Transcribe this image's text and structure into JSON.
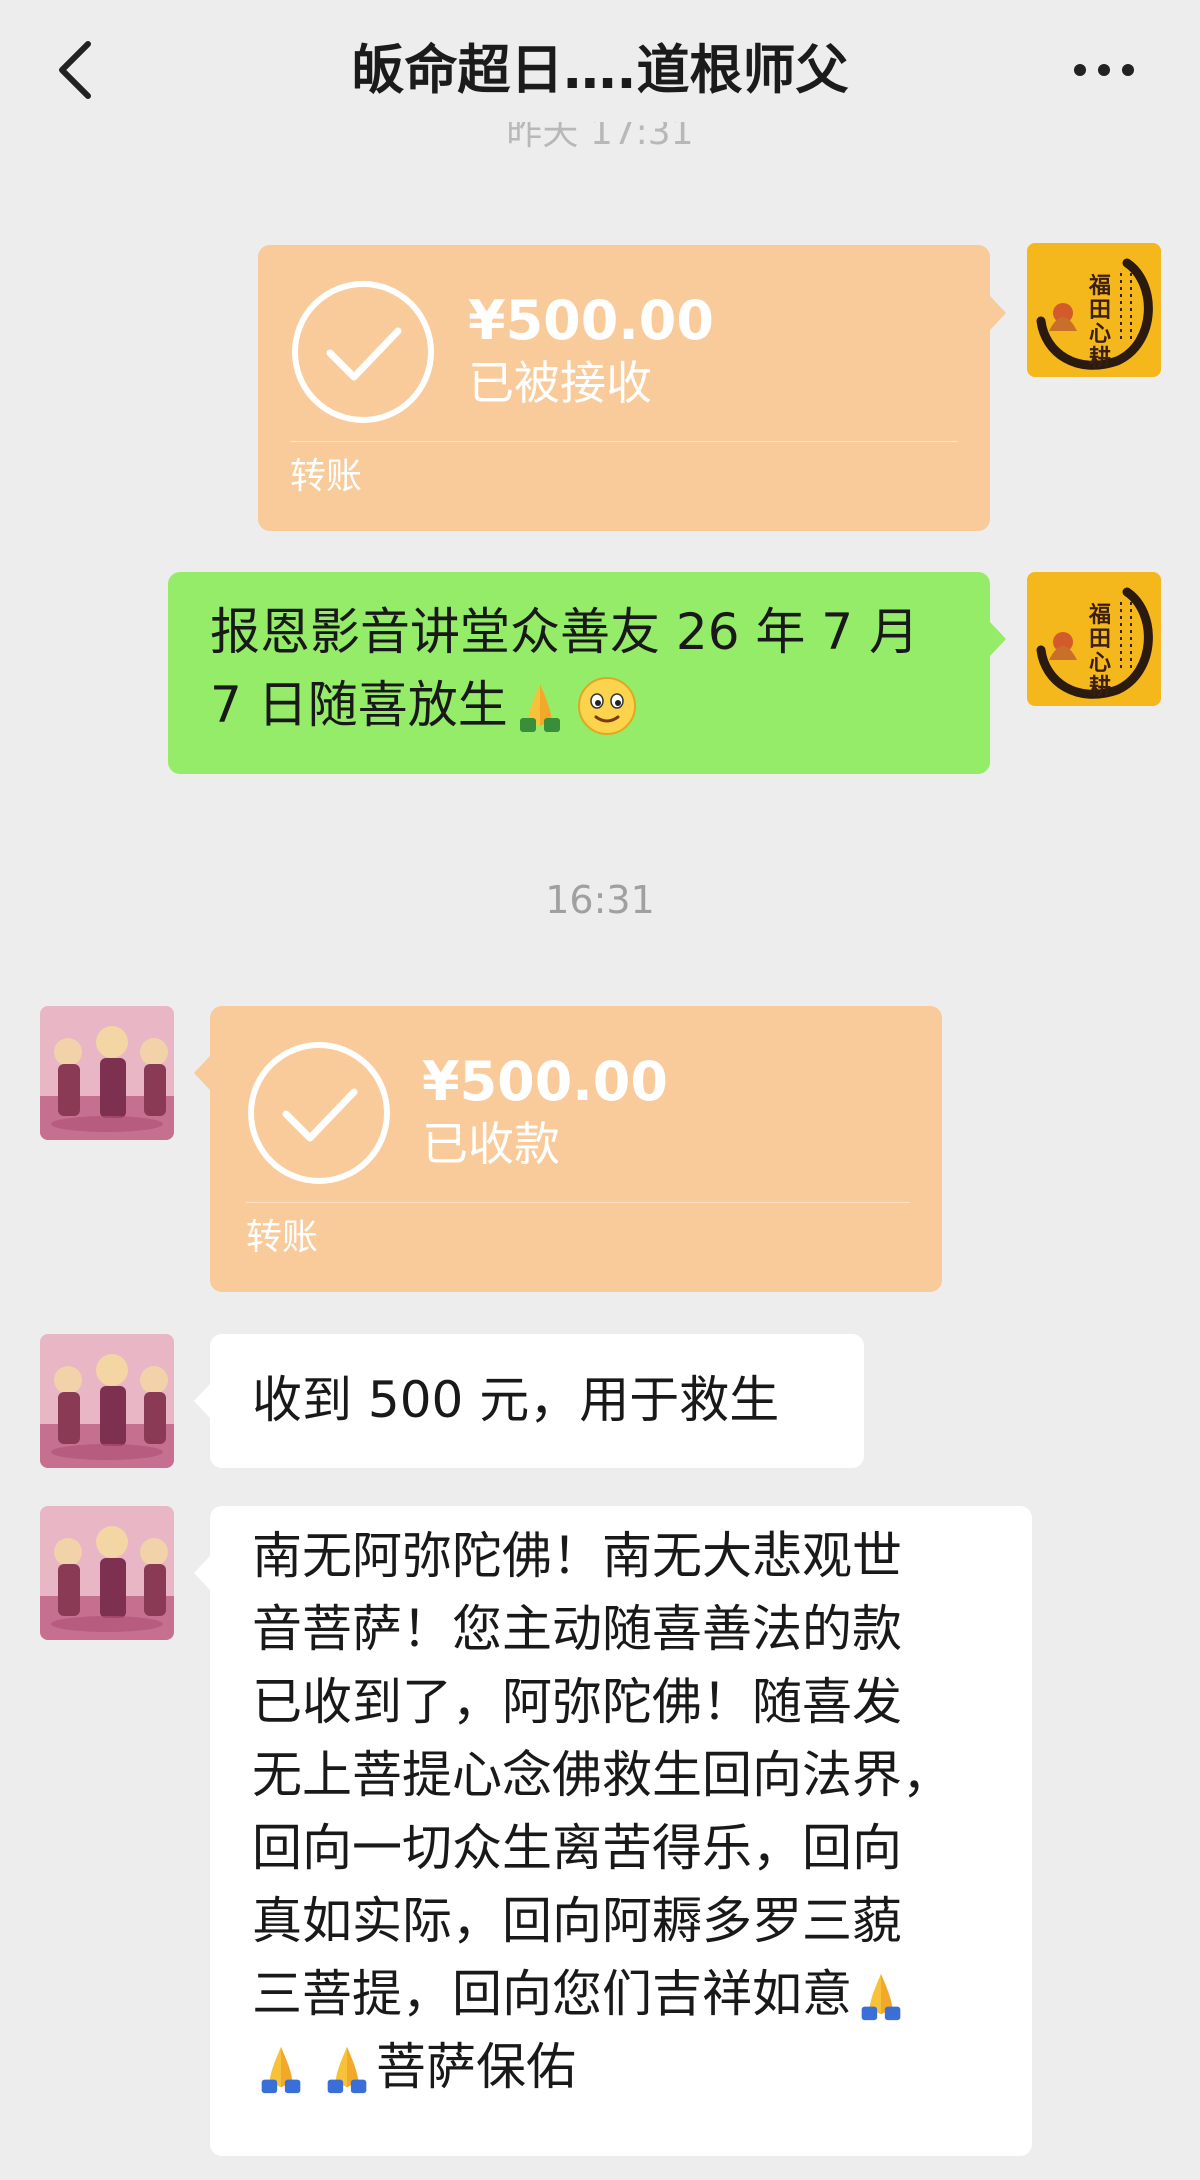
{
  "header": {
    "title": "皈命超日….道根师父",
    "back_icon": "chevron-left-icon",
    "more_icon": "more-dots-icon"
  },
  "faded_time": "昨天 17:31",
  "messages": {
    "transfer_sent": {
      "amount": "¥500.00",
      "status": "已被接收",
      "kind": "转账",
      "color": "#f9ca9a"
    },
    "text_sent": {
      "line1": "报恩影音讲堂众善友 26 年 7 月",
      "line2": "7 日随喜放生",
      "emoji": [
        "folded-hands-emoji",
        "smiling-face-emoji"
      ],
      "color": "#95ec69"
    },
    "time_label": "16:31",
    "transfer_received": {
      "amount": "¥500.00",
      "status": "已收款",
      "kind": "转账"
    },
    "reply_short": "收到 500 元，用于救生",
    "reply_long": {
      "lines": [
        "南无阿弥陀佛！南无大悲观世",
        "音菩萨！您主动随喜善法的款",
        "已收到了，阿弥陀佛！随喜发",
        "无上菩提心念佛救生回向法界，",
        "回向一切众生离苦得乐，回向",
        "真如实际，回向阿耨多罗三藐",
        "三菩提，回向您们吉祥如意",
        "菩萨保佑"
      ]
    }
  },
  "avatars": {
    "self": {
      "text": "福田心耕",
      "icon": "calligraphy-avatar"
    },
    "other": {
      "icon": "buddha-figures-avatar"
    }
  }
}
